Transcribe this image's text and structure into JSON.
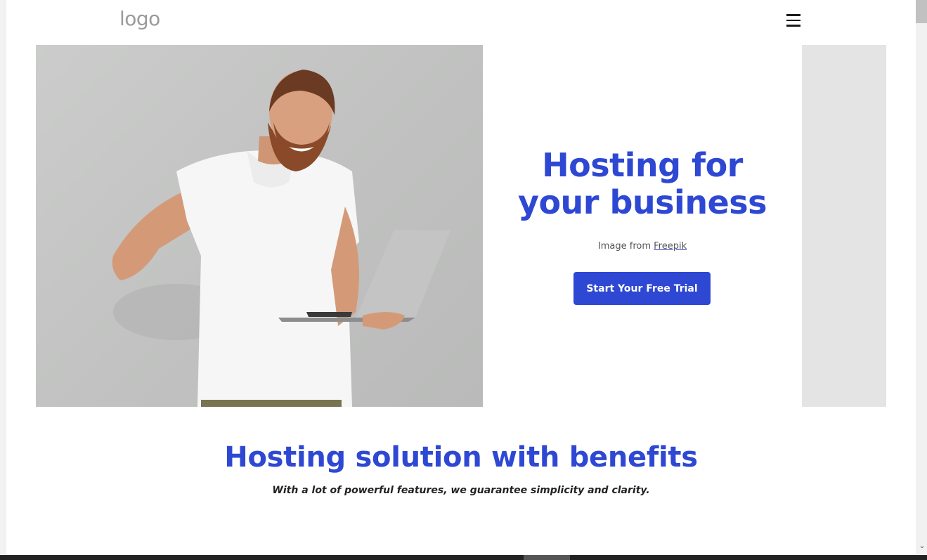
{
  "header": {
    "logo_text": "logo",
    "menu_icon": "hamburger-menu-icon"
  },
  "hero": {
    "image_alt": "Smiling man in white polo shirt pointing at himself while holding a laptop",
    "title_line1": "Hosting for",
    "title_line2": "your business",
    "credit_prefix": "Image from ",
    "credit_link": "Freepik",
    "cta_label": "Start Your Free Trial"
  },
  "benefits": {
    "title": "Hosting solution with benefits",
    "subtitle": "With a lot of powerful features, we guarantee simplicity and clarity."
  },
  "colors": {
    "brand_blue": "#2e48d3",
    "side_panel": "#e4e4e4"
  }
}
